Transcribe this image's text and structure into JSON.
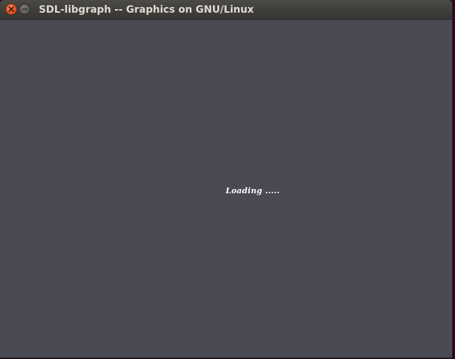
{
  "window": {
    "title": "SDL-libgraph -- Graphics on GNU/Linux",
    "close_icon": "close-icon",
    "minimize_icon": "minimize-icon",
    "accent_close": "#ea5a2a",
    "background": "#4a4a55"
  },
  "canvas": {
    "loading_text": "Loading ....."
  }
}
